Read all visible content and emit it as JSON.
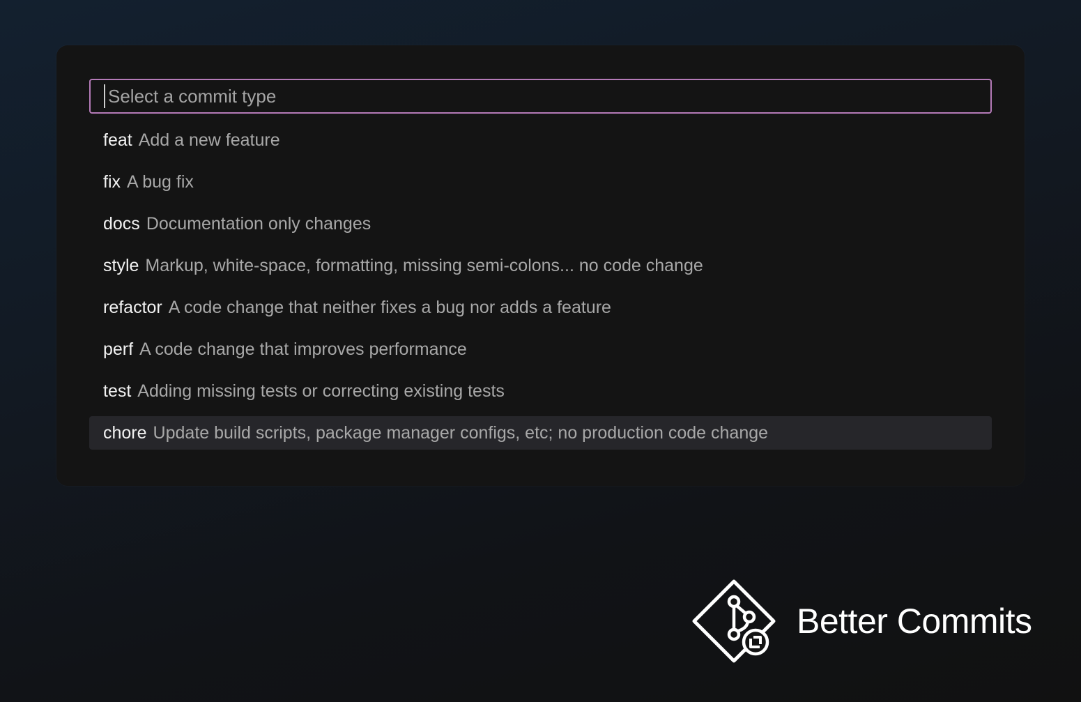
{
  "search": {
    "placeholder": "Select a commit type",
    "value": ""
  },
  "commit_types": [
    {
      "type": "feat",
      "description": "Add a new feature",
      "selected": false
    },
    {
      "type": "fix",
      "description": "A bug fix",
      "selected": false
    },
    {
      "type": "docs",
      "description": "Documentation only changes",
      "selected": false
    },
    {
      "type": "style",
      "description": "Markup, white-space, formatting, missing semi-colons... no code change",
      "selected": false
    },
    {
      "type": "refactor",
      "description": "A code change that neither fixes a bug nor adds a feature",
      "selected": false
    },
    {
      "type": "perf",
      "description": "A code change that improves performance",
      "selected": false
    },
    {
      "type": "test",
      "description": "Adding missing tests or correcting existing tests",
      "selected": false
    },
    {
      "type": "chore",
      "description": "Update build scripts, package manager configs, etc; no production code change",
      "selected": true
    }
  ],
  "brand": {
    "name": "Better Commits",
    "icon": "git-branch-diamond-logo"
  },
  "colors": {
    "focus_border": "#b57bb8",
    "selected_bg": "#26262a",
    "panel_bg": "#141414"
  }
}
